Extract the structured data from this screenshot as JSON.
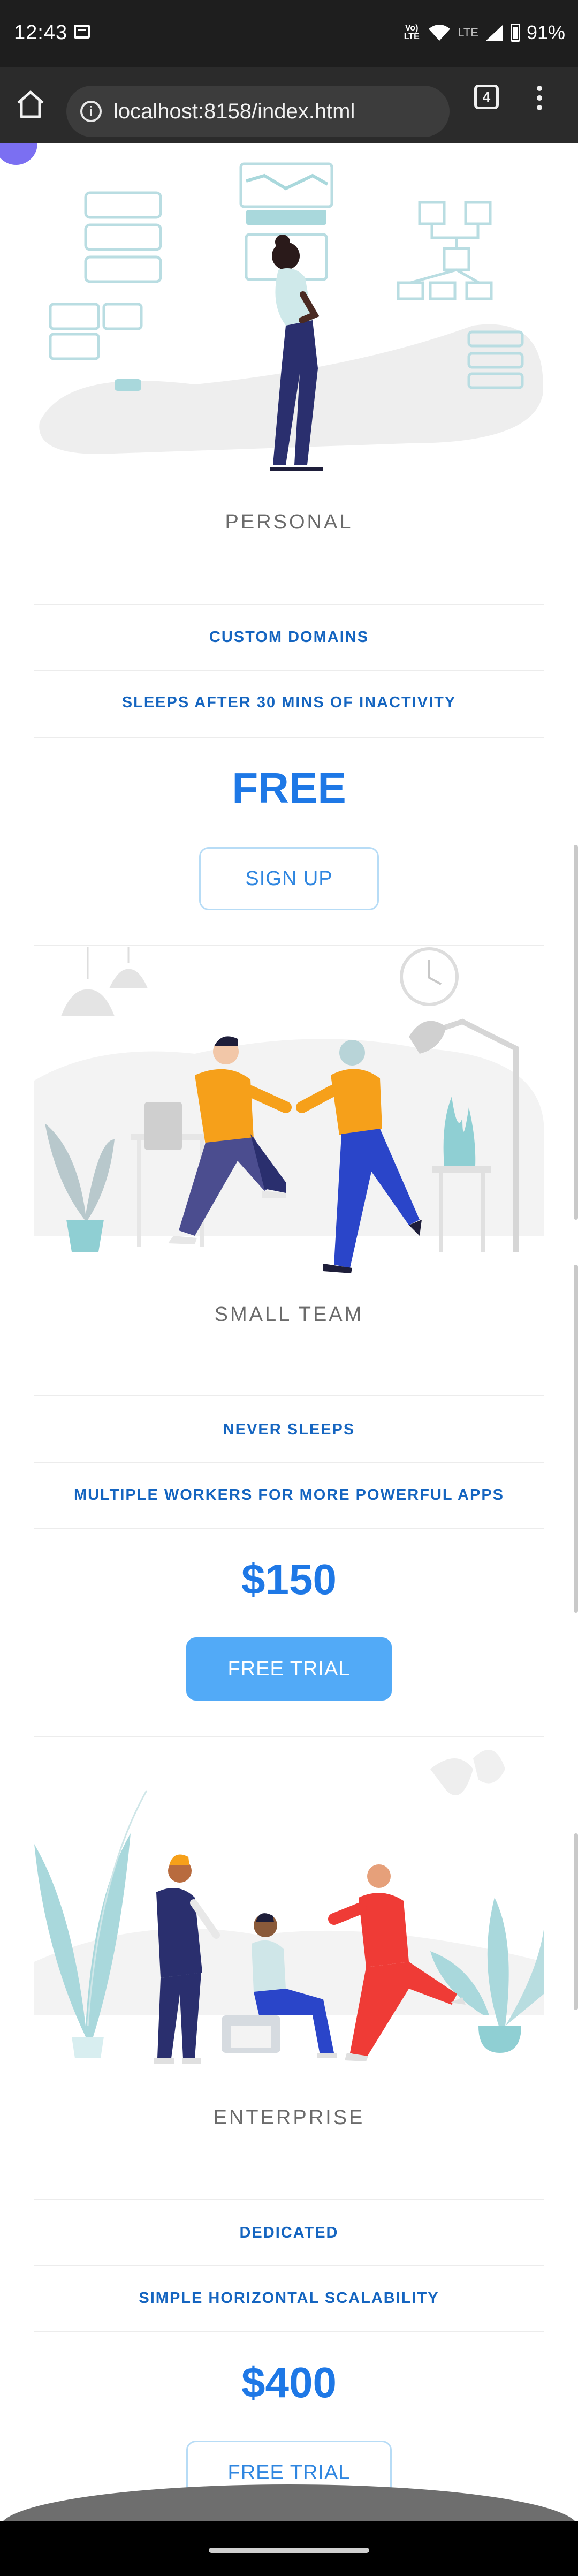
{
  "status_bar": {
    "time": "12:43",
    "volte_label": "Vo) LTE",
    "network_label": "LTE",
    "battery": "91%"
  },
  "browser": {
    "url": "localhost:8158/index.html",
    "tab_count": "4"
  },
  "plans": [
    {
      "name": "PERSONAL",
      "features": [
        "CUSTOM DOMAINS",
        "SLEEPS AFTER 30 MINS OF INACTIVITY"
      ],
      "price": "FREE",
      "button_label": "SIGN UP",
      "button_style": "outline"
    },
    {
      "name": "SMALL TEAM",
      "features": [
        "NEVER SLEEPS",
        "MULTIPLE WORKERS FOR MORE POWERFUL APPS"
      ],
      "price": "$150",
      "button_label": "FREE TRIAL",
      "button_style": "filled"
    },
    {
      "name": "ENTERPRISE",
      "features": [
        "DEDICATED",
        "SIMPLE HORIZONTAL SCALABILITY"
      ],
      "price": "$400",
      "button_label": "FREE TRIAL",
      "button_style": "outline"
    }
  ],
  "colors": {
    "accent_text": "#1565c0",
    "price": "#1e78e6",
    "button_filled": "#52aaf7",
    "illustration_teal": "#a9d8dc",
    "orange": "#f6a01a",
    "navy": "#2a2f6e",
    "red": "#ef3b36"
  }
}
